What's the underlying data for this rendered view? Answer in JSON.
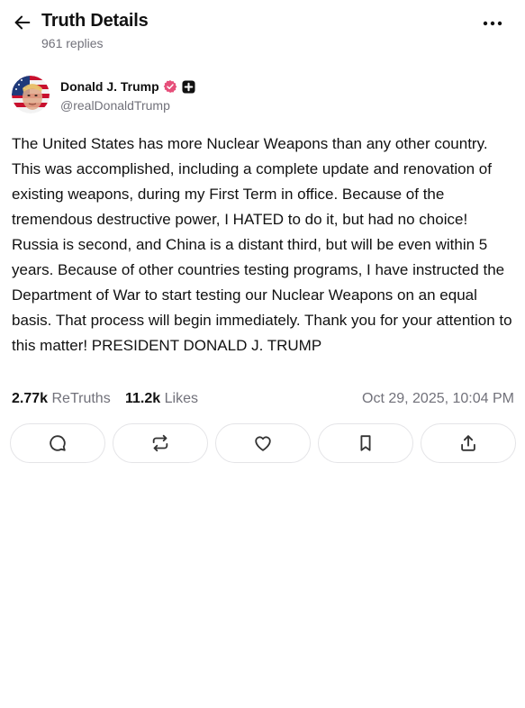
{
  "header": {
    "title": "Truth Details",
    "replies": "961 replies",
    "back_icon": "arrow-left-icon",
    "more_icon": "more-horizontal-icon"
  },
  "author": {
    "name": "Donald J. Trump",
    "handle": "@realDonaldTrump",
    "verified_color": "#e64f7a"
  },
  "post": {
    "text": "The United States has more Nuclear Weapons than any other country. This was accomplished, including a complete update and renovation of existing weapons, during my First Term in office. Because of the tremendous destructive power, I HATED to do it, but had no choice! Russia is second, and China is a distant third, but will be even within 5 years. Because of other countries testing programs, I have instructed the Department of War to start testing our Nuclear Weapons on an equal basis. That process will begin immediately. Thank you for your attention to this matter! PRESIDENT DONALD J. TRUMP"
  },
  "stats": {
    "retruths_count": "2.77k",
    "retruths_label": "ReTruths",
    "likes_count": "11.2k",
    "likes_label": "Likes",
    "date": "Oct 29, 2025, 10:04 PM"
  },
  "actions": [
    {
      "icon": "reply-icon"
    },
    {
      "icon": "retruth-icon"
    },
    {
      "icon": "heart-icon"
    },
    {
      "icon": "bookmark-icon"
    },
    {
      "icon": "share-icon"
    }
  ]
}
